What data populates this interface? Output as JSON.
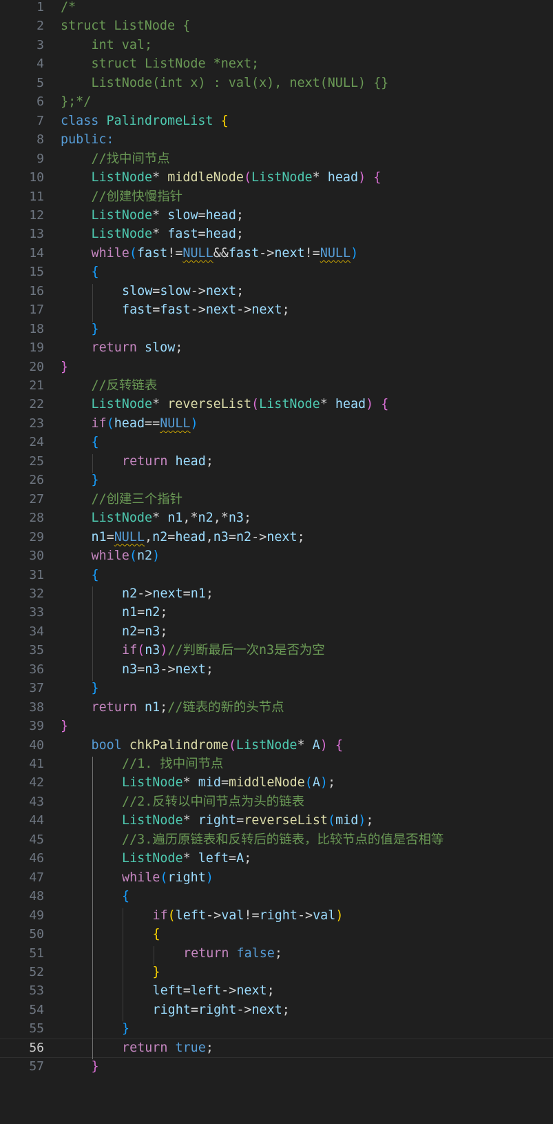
{
  "editor": {
    "language": "C++",
    "current_line": 56,
    "colors": {
      "background": "#1f1f1f",
      "line_number": "#6e7681",
      "comment": "#6a9955",
      "keyword": "#569cd6",
      "control": "#c586c0",
      "type": "#4ec9b0",
      "function": "#dcdcaa",
      "variable": "#9cdcfe",
      "plain": "#d4d4d4",
      "bracket_gold": "#ffd700",
      "bracket_orchid": "#da70d6",
      "bracket_blue": "#179fff",
      "warning_squiggle": "#cca700"
    },
    "lines": [
      {
        "n": "1",
        "ind": 0,
        "t": [
          [
            "/*",
            "comment"
          ]
        ]
      },
      {
        "n": "2",
        "ind": 0,
        "t": [
          [
            "struct ListNode {",
            "comment"
          ]
        ]
      },
      {
        "n": "3",
        "ind": 1,
        "t": [
          [
            "int val;",
            "comment"
          ]
        ]
      },
      {
        "n": "4",
        "ind": 1,
        "t": [
          [
            "struct ListNode *next;",
            "comment"
          ]
        ]
      },
      {
        "n": "5",
        "ind": 1,
        "t": [
          [
            "ListNode(int x) : val(x), next(NULL) {}",
            "comment"
          ]
        ]
      },
      {
        "n": "6",
        "ind": 0,
        "t": [
          [
            "};*/",
            "comment"
          ]
        ]
      },
      {
        "n": "7",
        "ind": 0,
        "t": [
          [
            "class",
            "keyword"
          ],
          [
            " ",
            "plain"
          ],
          [
            "PalindromeList",
            "type"
          ],
          [
            " ",
            "plain"
          ],
          [
            "{",
            "brace1"
          ]
        ]
      },
      {
        "n": "8",
        "ind": 0,
        "t": [
          [
            "public:",
            "keyword"
          ]
        ]
      },
      {
        "n": "9",
        "ind": 1,
        "t": [
          [
            "//找中间节点",
            "comment"
          ]
        ]
      },
      {
        "n": "10",
        "ind": 1,
        "t": [
          [
            "ListNode",
            "type"
          ],
          [
            "* ",
            "plain"
          ],
          [
            "middleNode",
            "func"
          ],
          [
            "(",
            "brace2"
          ],
          [
            "ListNode",
            "type"
          ],
          [
            "* ",
            "plain"
          ],
          [
            "head",
            "var"
          ],
          [
            ")",
            "brace2"
          ],
          [
            " ",
            "plain"
          ],
          [
            "{",
            "brace2"
          ]
        ]
      },
      {
        "n": "11",
        "ind": 1,
        "t": [
          [
            "//创建快慢指针",
            "comment"
          ]
        ]
      },
      {
        "n": "12",
        "ind": 1,
        "t": [
          [
            "ListNode",
            "type"
          ],
          [
            "* ",
            "plain"
          ],
          [
            "slow",
            "var"
          ],
          [
            "=",
            "plain"
          ],
          [
            "head",
            "var"
          ],
          [
            ";",
            "plain"
          ]
        ]
      },
      {
        "n": "13",
        "ind": 1,
        "t": [
          [
            "ListNode",
            "type"
          ],
          [
            "* ",
            "plain"
          ],
          [
            "fast",
            "var"
          ],
          [
            "=",
            "plain"
          ],
          [
            "head",
            "var"
          ],
          [
            ";",
            "plain"
          ]
        ]
      },
      {
        "n": "14",
        "ind": 1,
        "t": [
          [
            "while",
            "control"
          ],
          [
            "(",
            "brace3"
          ],
          [
            "fast",
            "var"
          ],
          [
            "!=",
            "plain"
          ],
          [
            "NULL",
            "keyword",
            "sq"
          ],
          [
            "&&",
            "plain"
          ],
          [
            "fast",
            "var"
          ],
          [
            "->",
            "plain"
          ],
          [
            "next",
            "var"
          ],
          [
            "!=",
            "plain"
          ],
          [
            "NULL",
            "keyword",
            "sq"
          ],
          [
            ")",
            "brace3"
          ]
        ]
      },
      {
        "n": "15",
        "ind": 1,
        "t": [
          [
            "{",
            "brace3"
          ]
        ]
      },
      {
        "n": "16",
        "ind": 2,
        "t": [
          [
            "slow",
            "var"
          ],
          [
            "=",
            "plain"
          ],
          [
            "slow",
            "var"
          ],
          [
            "->",
            "plain"
          ],
          [
            "next",
            "var"
          ],
          [
            ";",
            "plain"
          ]
        ]
      },
      {
        "n": "17",
        "ind": 2,
        "t": [
          [
            "fast",
            "var"
          ],
          [
            "=",
            "plain"
          ],
          [
            "fast",
            "var"
          ],
          [
            "->",
            "plain"
          ],
          [
            "next",
            "var"
          ],
          [
            "->",
            "plain"
          ],
          [
            "next",
            "var"
          ],
          [
            ";",
            "plain"
          ]
        ]
      },
      {
        "n": "18",
        "ind": 1,
        "t": [
          [
            "}",
            "brace3"
          ]
        ]
      },
      {
        "n": "19",
        "ind": 1,
        "t": [
          [
            "return",
            "control"
          ],
          [
            " ",
            "plain"
          ],
          [
            "slow",
            "var"
          ],
          [
            ";",
            "plain"
          ]
        ]
      },
      {
        "n": "20",
        "ind": 0,
        "t": [
          [
            "}",
            "brace2"
          ]
        ]
      },
      {
        "n": "21",
        "ind": 1,
        "t": [
          [
            "//反转链表",
            "comment"
          ]
        ]
      },
      {
        "n": "22",
        "ind": 1,
        "t": [
          [
            "ListNode",
            "type"
          ],
          [
            "* ",
            "plain"
          ],
          [
            "reverseList",
            "func"
          ],
          [
            "(",
            "brace2"
          ],
          [
            "ListNode",
            "type"
          ],
          [
            "* ",
            "plain"
          ],
          [
            "head",
            "var"
          ],
          [
            ")",
            "brace2"
          ],
          [
            " ",
            "plain"
          ],
          [
            "{",
            "brace2"
          ]
        ]
      },
      {
        "n": "23",
        "ind": 1,
        "t": [
          [
            "if",
            "control"
          ],
          [
            "(",
            "brace3"
          ],
          [
            "head",
            "var"
          ],
          [
            "==",
            "plain"
          ],
          [
            "NULL",
            "keyword",
            "sq"
          ],
          [
            ")",
            "brace3"
          ]
        ]
      },
      {
        "n": "24",
        "ind": 1,
        "t": [
          [
            "{",
            "brace3"
          ]
        ]
      },
      {
        "n": "25",
        "ind": 2,
        "t": [
          [
            "return",
            "control"
          ],
          [
            " ",
            "plain"
          ],
          [
            "head",
            "var"
          ],
          [
            ";",
            "plain"
          ]
        ]
      },
      {
        "n": "26",
        "ind": 1,
        "t": [
          [
            "}",
            "brace3"
          ]
        ]
      },
      {
        "n": "27",
        "ind": 1,
        "t": [
          [
            "//创建三个指针",
            "comment"
          ]
        ]
      },
      {
        "n": "28",
        "ind": 1,
        "t": [
          [
            "ListNode",
            "type"
          ],
          [
            "* ",
            "plain"
          ],
          [
            "n1",
            "var"
          ],
          [
            ",*",
            "plain"
          ],
          [
            "n2",
            "var"
          ],
          [
            ",*",
            "plain"
          ],
          [
            "n3",
            "var"
          ],
          [
            ";",
            "plain"
          ]
        ]
      },
      {
        "n": "29",
        "ind": 1,
        "t": [
          [
            "n1",
            "var"
          ],
          [
            "=",
            "plain"
          ],
          [
            "NULL",
            "keyword",
            "sq"
          ],
          [
            ",",
            "plain"
          ],
          [
            "n2",
            "var"
          ],
          [
            "=",
            "plain"
          ],
          [
            "head",
            "var"
          ],
          [
            ",",
            "plain"
          ],
          [
            "n3",
            "var"
          ],
          [
            "=",
            "plain"
          ],
          [
            "n2",
            "var"
          ],
          [
            "->",
            "plain"
          ],
          [
            "next",
            "var"
          ],
          [
            ";",
            "plain"
          ]
        ]
      },
      {
        "n": "30",
        "ind": 1,
        "t": [
          [
            "while",
            "control"
          ],
          [
            "(",
            "brace3"
          ],
          [
            "n2",
            "var"
          ],
          [
            ")",
            "brace3"
          ]
        ]
      },
      {
        "n": "31",
        "ind": 1,
        "t": [
          [
            "{",
            "brace3"
          ]
        ]
      },
      {
        "n": "32",
        "ind": 2,
        "t": [
          [
            "n2",
            "var"
          ],
          [
            "->",
            "plain"
          ],
          [
            "next",
            "var"
          ],
          [
            "=",
            "plain"
          ],
          [
            "n1",
            "var"
          ],
          [
            ";",
            "plain"
          ]
        ]
      },
      {
        "n": "33",
        "ind": 2,
        "t": [
          [
            "n1",
            "var"
          ],
          [
            "=",
            "plain"
          ],
          [
            "n2",
            "var"
          ],
          [
            ";",
            "plain"
          ]
        ]
      },
      {
        "n": "34",
        "ind": 2,
        "t": [
          [
            "n2",
            "var"
          ],
          [
            "=",
            "plain"
          ],
          [
            "n3",
            "var"
          ],
          [
            ";",
            "plain"
          ]
        ]
      },
      {
        "n": "35",
        "ind": 2,
        "t": [
          [
            "if",
            "control"
          ],
          [
            "(",
            "brace2"
          ],
          [
            "n3",
            "var"
          ],
          [
            ")",
            "brace2"
          ],
          [
            "//判断最后一次n3是否为空",
            "comment"
          ]
        ]
      },
      {
        "n": "36",
        "ind": 2,
        "t": [
          [
            "n3",
            "var"
          ],
          [
            "=",
            "plain"
          ],
          [
            "n3",
            "var"
          ],
          [
            "->",
            "plain"
          ],
          [
            "next",
            "var"
          ],
          [
            ";",
            "plain"
          ]
        ]
      },
      {
        "n": "37",
        "ind": 1,
        "t": [
          [
            "}",
            "brace3"
          ]
        ]
      },
      {
        "n": "38",
        "ind": 1,
        "t": [
          [
            "return",
            "control"
          ],
          [
            " ",
            "plain"
          ],
          [
            "n1",
            "var"
          ],
          [
            ";",
            "plain"
          ],
          [
            "//链表的新的头节点",
            "comment"
          ]
        ]
      },
      {
        "n": "39",
        "ind": 0,
        "t": [
          [
            "}",
            "brace2"
          ]
        ]
      },
      {
        "n": "40",
        "ind": 1,
        "t": [
          [
            "bool",
            "keyword"
          ],
          [
            " ",
            "plain"
          ],
          [
            "chkPalindrome",
            "func"
          ],
          [
            "(",
            "brace2"
          ],
          [
            "ListNode",
            "type"
          ],
          [
            "* ",
            "plain"
          ],
          [
            "A",
            "var"
          ],
          [
            ")",
            "brace2"
          ],
          [
            " ",
            "plain"
          ],
          [
            "{",
            "brace2"
          ]
        ]
      },
      {
        "n": "41",
        "ind": 2,
        "t": [
          [
            "//1. 找中间节点",
            "comment"
          ]
        ]
      },
      {
        "n": "42",
        "ind": 2,
        "t": [
          [
            "ListNode",
            "type"
          ],
          [
            "* ",
            "plain"
          ],
          [
            "mid",
            "var"
          ],
          [
            "=",
            "plain"
          ],
          [
            "middleNode",
            "func"
          ],
          [
            "(",
            "brace3"
          ],
          [
            "A",
            "var"
          ],
          [
            ")",
            "brace3"
          ],
          [
            ";",
            "plain"
          ]
        ]
      },
      {
        "n": "43",
        "ind": 2,
        "t": [
          [
            "//2.反转以中间节点为头的链表",
            "comment"
          ]
        ]
      },
      {
        "n": "44",
        "ind": 2,
        "t": [
          [
            "ListNode",
            "type"
          ],
          [
            "* ",
            "plain"
          ],
          [
            "right",
            "var"
          ],
          [
            "=",
            "plain"
          ],
          [
            "reverseList",
            "func"
          ],
          [
            "(",
            "brace3"
          ],
          [
            "mid",
            "var"
          ],
          [
            ")",
            "brace3"
          ],
          [
            ";",
            "plain"
          ]
        ]
      },
      {
        "n": "45",
        "ind": 2,
        "t": [
          [
            "//3.遍历原链表和反转后的链表，比较节点的值是否相等",
            "comment"
          ]
        ]
      },
      {
        "n": "46",
        "ind": 2,
        "t": [
          [
            "ListNode",
            "type"
          ],
          [
            "* ",
            "plain"
          ],
          [
            "left",
            "var"
          ],
          [
            "=",
            "plain"
          ],
          [
            "A",
            "var"
          ],
          [
            ";",
            "plain"
          ]
        ]
      },
      {
        "n": "47",
        "ind": 2,
        "t": [
          [
            "while",
            "control"
          ],
          [
            "(",
            "brace3"
          ],
          [
            "right",
            "var"
          ],
          [
            ")",
            "brace3"
          ]
        ]
      },
      {
        "n": "48",
        "ind": 2,
        "t": [
          [
            "{",
            "brace3"
          ]
        ]
      },
      {
        "n": "49",
        "ind": 3,
        "t": [
          [
            "if",
            "control"
          ],
          [
            "(",
            "brace1"
          ],
          [
            "left",
            "var"
          ],
          [
            "->",
            "plain"
          ],
          [
            "val",
            "var"
          ],
          [
            "!=",
            "plain"
          ],
          [
            "right",
            "var"
          ],
          [
            "->",
            "plain"
          ],
          [
            "val",
            "var"
          ],
          [
            ")",
            "brace1"
          ]
        ]
      },
      {
        "n": "50",
        "ind": 3,
        "t": [
          [
            "{",
            "brace1"
          ]
        ]
      },
      {
        "n": "51",
        "ind": 4,
        "t": [
          [
            "return",
            "control"
          ],
          [
            " ",
            "plain"
          ],
          [
            "false",
            "keyword"
          ],
          [
            ";",
            "plain"
          ]
        ]
      },
      {
        "n": "52",
        "ind": 3,
        "t": [
          [
            "}",
            "brace1"
          ]
        ]
      },
      {
        "n": "53",
        "ind": 3,
        "t": [
          [
            "left",
            "var"
          ],
          [
            "=",
            "plain"
          ],
          [
            "left",
            "var"
          ],
          [
            "->",
            "plain"
          ],
          [
            "next",
            "var"
          ],
          [
            ";",
            "plain"
          ]
        ]
      },
      {
        "n": "54",
        "ind": 3,
        "t": [
          [
            "right",
            "var"
          ],
          [
            "=",
            "plain"
          ],
          [
            "right",
            "var"
          ],
          [
            "->",
            "plain"
          ],
          [
            "next",
            "var"
          ],
          [
            ";",
            "plain"
          ]
        ]
      },
      {
        "n": "55",
        "ind": 2,
        "t": [
          [
            "}",
            "brace3"
          ]
        ]
      },
      {
        "n": "56",
        "ind": 2,
        "t": [
          [
            "return",
            "control"
          ],
          [
            " ",
            "plain"
          ],
          [
            "true",
            "keyword"
          ],
          [
            ";",
            "plain"
          ]
        ]
      },
      {
        "n": "57",
        "ind": 1,
        "t": [
          [
            "}",
            "brace2"
          ]
        ]
      }
    ]
  }
}
